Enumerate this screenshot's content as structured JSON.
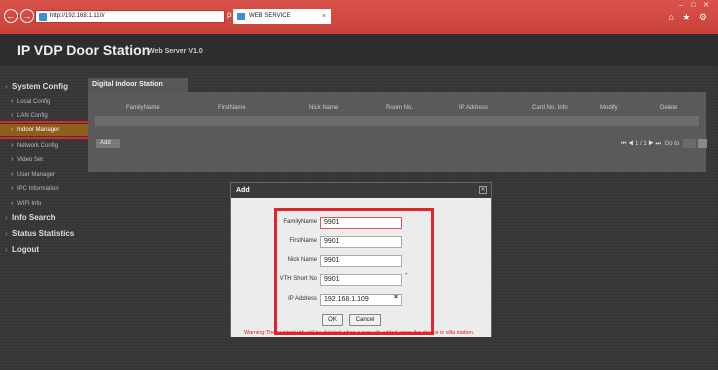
{
  "browser": {
    "url": "http://192.168.1.110/",
    "tab_title": "WEB SERVICE",
    "tab_close": "×",
    "addr_controls": "ρ ▾ ↻",
    "back": "←",
    "forward": "→",
    "window_controls": "– □ ✕",
    "tools": "⌂ ★ ⚙"
  },
  "app": {
    "title": "IP VDP Door Station",
    "subtitle": "Web Server V1.0"
  },
  "sidebar": {
    "system_config": "System Config",
    "local_config": "Local Config",
    "lan_config": "LAN Config",
    "indoor_manager": "Indoor Manager",
    "network_config": "Network Config",
    "video_set": "Video Set",
    "user_manager": "User Manager",
    "ipc_information": "IPC Information",
    "wifi_info": "WIFI Info",
    "info_search": "Info Search",
    "status_statistics": "Status Statistics",
    "logout": "Logout"
  },
  "content": {
    "tab_label": "Digital Indoor Station Manager",
    "columns": [
      "FamilyName",
      "FirstName",
      "Nick Name",
      "Room No.",
      "IP Address",
      "Card No. Info",
      "Modify",
      "Delete"
    ],
    "add_label": "Add",
    "pager_arrows": "⏮ ◀ 1 / 1 ▶ ⏭",
    "goto_label": "Go to"
  },
  "dialog": {
    "title": "Add",
    "close": "✕",
    "family_name_label": "FamilyName",
    "family_name_value": "9901",
    "first_name_label": "FirstName",
    "first_name_value": "9901",
    "nick_name_label": "Nick Name",
    "nick_name_value": "9901",
    "vth_short_no_label": "VTH Short No",
    "vth_short_no_value": "9901",
    "required_mark": "*",
    "ip_address_label": "IP Address",
    "ip_address_value": "192.168.1.109",
    "ip_clear": "×",
    "ok_label": "OK",
    "cancel_label": "Cancel",
    "warning": "Warning:The existent vth will be deleted when a new vth added since the device is villa station."
  },
  "colors": {
    "browser_bar": "#c9423a",
    "highlight": "#e0262b",
    "active_menu": "#8e5e1d",
    "warning_text": "#dd2222"
  }
}
